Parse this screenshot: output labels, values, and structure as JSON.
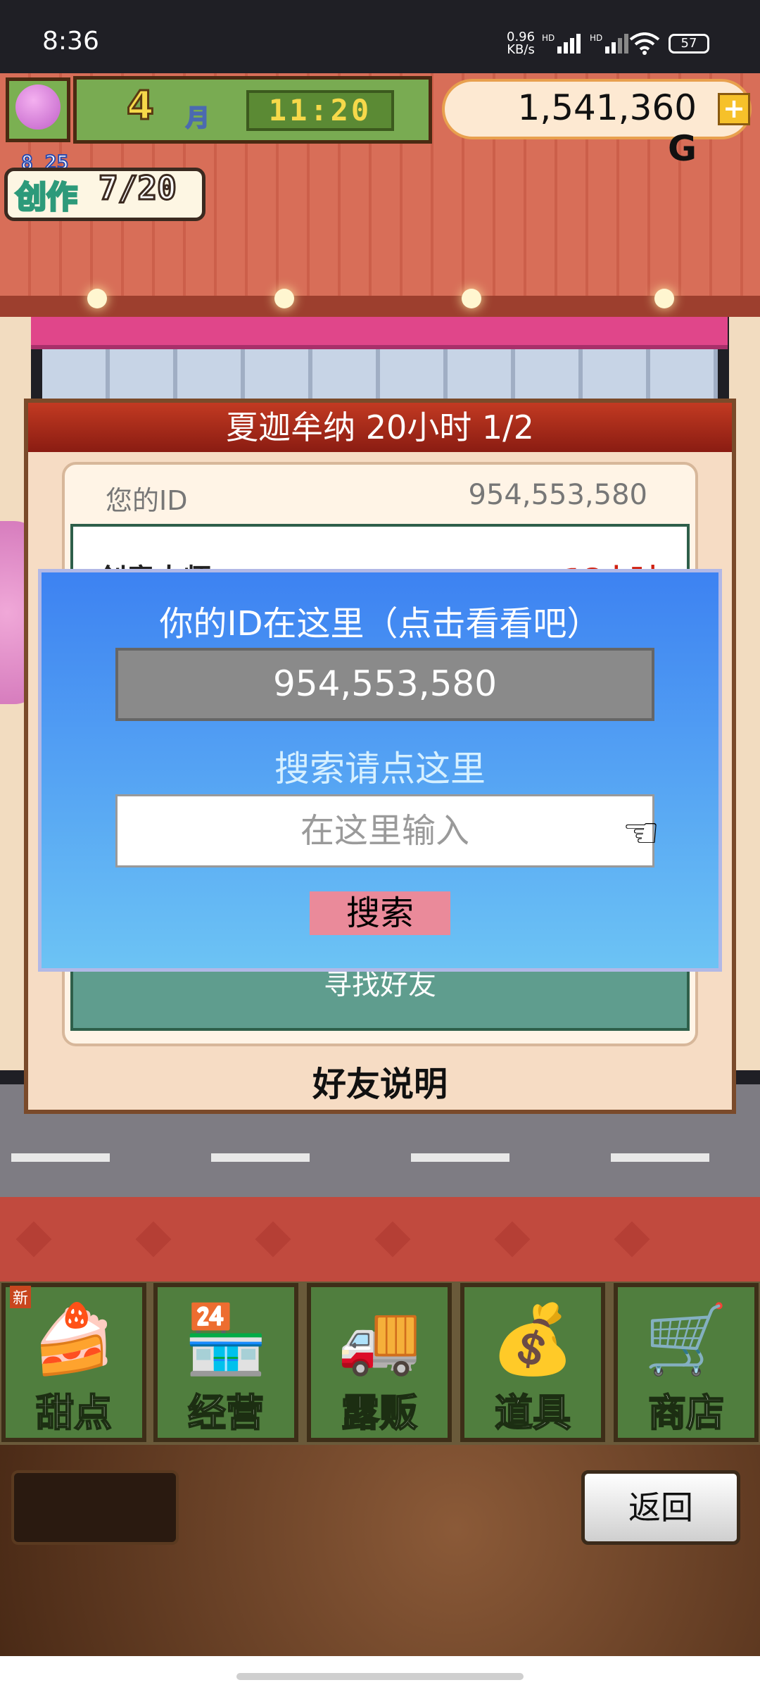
{
  "status_bar": {
    "time": "8:36",
    "net_speed_value": "0.96",
    "net_speed_unit": "KB/s",
    "hd1": "HD",
    "hd2": "HD",
    "battery": "57"
  },
  "hud": {
    "month_number": "4",
    "month_label": "月",
    "clock": "11:20",
    "money": "1,541,360",
    "currency": "G",
    "add_label": "+",
    "date": "8 25",
    "create_label": "创作",
    "create_value": "7/20"
  },
  "friend_panel": {
    "title": "夏迦牟纳  20小时 1/2",
    "your_id_label": "您的ID",
    "your_id_value": "954,553,580",
    "peek_left": "创意大师",
    "peek_right": "18小时",
    "find_friend": "寻找好友",
    "explanation": "好友说明"
  },
  "dialog": {
    "title": "你的ID在这里（点击看看吧）",
    "id_value": "954,553,580",
    "search_hint": "搜索请点这里",
    "search_placeholder": "在这里输入",
    "search_button": "搜索"
  },
  "menu": {
    "new_tag": "新",
    "items": [
      {
        "label": "甜点",
        "icon": "cake-icon"
      },
      {
        "label": "经营",
        "icon": "shop-building-icon"
      },
      {
        "label": "露贩",
        "icon": "food-truck-icon"
      },
      {
        "label": "道具",
        "icon": "item-bag-icon"
      },
      {
        "label": "商店",
        "icon": "shopping-cart-icon"
      }
    ]
  },
  "back_button": "返回"
}
